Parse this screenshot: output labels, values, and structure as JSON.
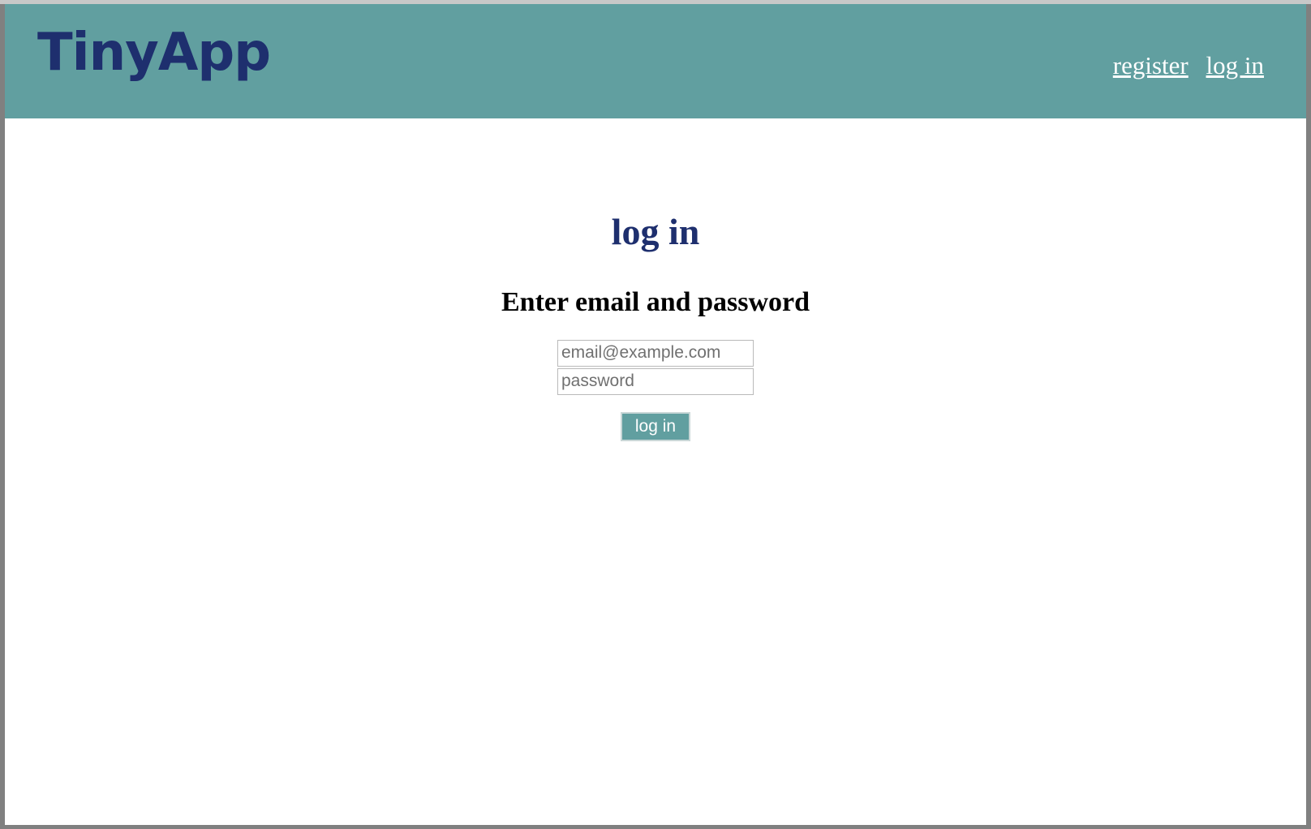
{
  "header": {
    "logo": "TinyApp",
    "nav": {
      "register": "register",
      "login": "log in"
    },
    "background_color": "#619fa0",
    "logo_color": "#1e2f6e"
  },
  "main": {
    "title": "log in",
    "subtitle": "Enter email and password",
    "form": {
      "email_placeholder": "email@example.com",
      "password_placeholder": "password",
      "submit_label": "log in"
    }
  }
}
